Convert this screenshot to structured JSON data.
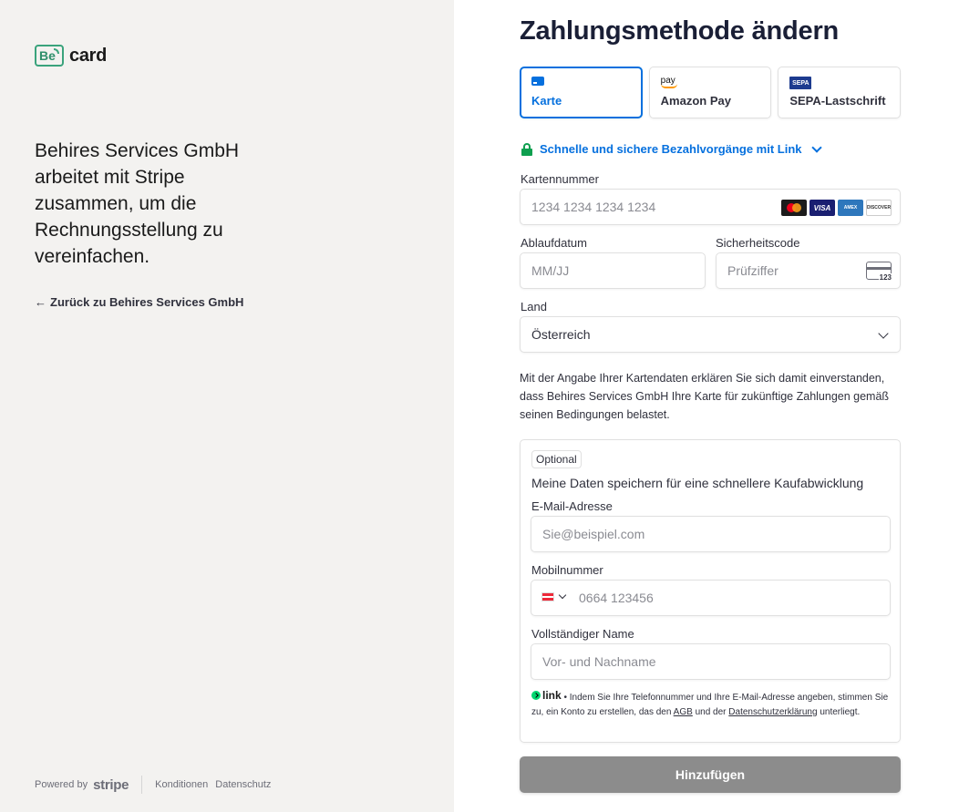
{
  "brand": {
    "badge_text": "Be",
    "wordmark": "card",
    "accent": "#3aa37c"
  },
  "merchant": {
    "description": "Behires Services GmbH arbeitet mit Stripe zusammen, um die Rechnungsstellung zu vereinfachen.",
    "back_link": "Zurück zu Behires Services GmbH"
  },
  "footer": {
    "powered_by": "Powered by",
    "stripe": "stripe",
    "terms": "Konditionen",
    "privacy": "Datenschutz"
  },
  "form": {
    "title": "Zahlungsmethode ändern",
    "tabs": [
      {
        "label": "Karte",
        "icon": "card-icon",
        "active": true
      },
      {
        "label": "Amazon Pay",
        "icon": "amazon-pay-icon",
        "active": false
      },
      {
        "label": "SEPA-Lastschrift",
        "icon": "sepa-icon",
        "active": false
      }
    ],
    "link_prompt": "Schnelle und sichere Bezahlvorgänge mit Link",
    "card_number": {
      "label": "Kartennummer",
      "placeholder": "1234 1234 1234 1234"
    },
    "card_brands": [
      "mastercard",
      "VISA",
      "AMEX",
      "DISCOVER"
    ],
    "expiry": {
      "label": "Ablaufdatum",
      "placeholder": "MM/JJ"
    },
    "cvc": {
      "label": "Sicherheitscode",
      "placeholder": "Prüfziffer",
      "icon_text": "123"
    },
    "country": {
      "label": "Land",
      "value": "Österreich"
    },
    "consent": "Mit der Angabe Ihrer Kartendaten erklären Sie sich damit einverstanden, dass Behires Services GmbH Ihre Karte für zukünftige Zahlungen gemäß seinen Bedingungen belastet.",
    "link_box": {
      "optional": "Optional",
      "save_text": "Meine Daten speichern für eine schnellere Kaufabwicklung",
      "email": {
        "label": "E-Mail-Adresse",
        "placeholder": "Sie@beispiel.com"
      },
      "phone": {
        "label": "Mobilnummer",
        "placeholder": "0664 123456"
      },
      "name": {
        "label": "Vollständiger Name",
        "placeholder": "Vor- und Nachname"
      },
      "legal_logo": "link",
      "legal_pre": " • Indem Sie Ihre Telefonnummer und Ihre E-Mail-Adresse angeben, stimmen Sie zu, ein Konto zu erstellen, das den ",
      "legal_agb": "AGB",
      "legal_mid": " und der ",
      "legal_privacy": "Datenschutzerklärung",
      "legal_post": " unterliegt."
    },
    "submit_label": "Hinzufügen",
    "accent": "#0570de"
  }
}
